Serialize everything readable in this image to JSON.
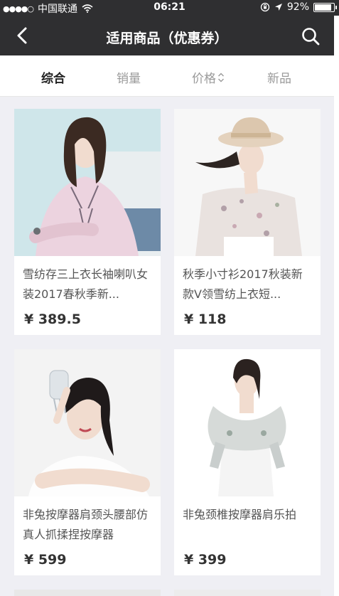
{
  "status_bar": {
    "signal": "●●●●○",
    "carrier": "中国联通",
    "time": "06:21",
    "battery_label": "92%",
    "battery_level": 0.92
  },
  "nav": {
    "title": "适用商品（优惠券）"
  },
  "tabs": [
    {
      "label": "综合",
      "active": true
    },
    {
      "label": "销量",
      "active": false
    },
    {
      "label": "价格",
      "active": false
    },
    {
      "label": "新品",
      "active": false
    }
  ],
  "products": [
    {
      "title": "雪纺存三上衣长袖喇叭女装2017春秋季新...",
      "price": "¥ 389.5",
      "photo": "woman-pink-blouse"
    },
    {
      "title": "秋季小寸衫2017秋装新款V领雪纺上衣短...",
      "price": "¥ 118",
      "photo": "woman-sun-hat"
    },
    {
      "title": "非兔按摩器肩颈头腰部仿真人抓揉捏按摩器",
      "price": "¥ 599",
      "photo": "woman-head-massager"
    },
    {
      "title": "非兔颈椎按摩器肩乐拍",
      "price": "¥ 399",
      "photo": "woman-neck-massager"
    }
  ],
  "colors": {
    "bar": "#2f2f31",
    "page_bg": "#efeff4",
    "active_tab": "#222222",
    "inactive_tab": "#9a9a9a"
  }
}
